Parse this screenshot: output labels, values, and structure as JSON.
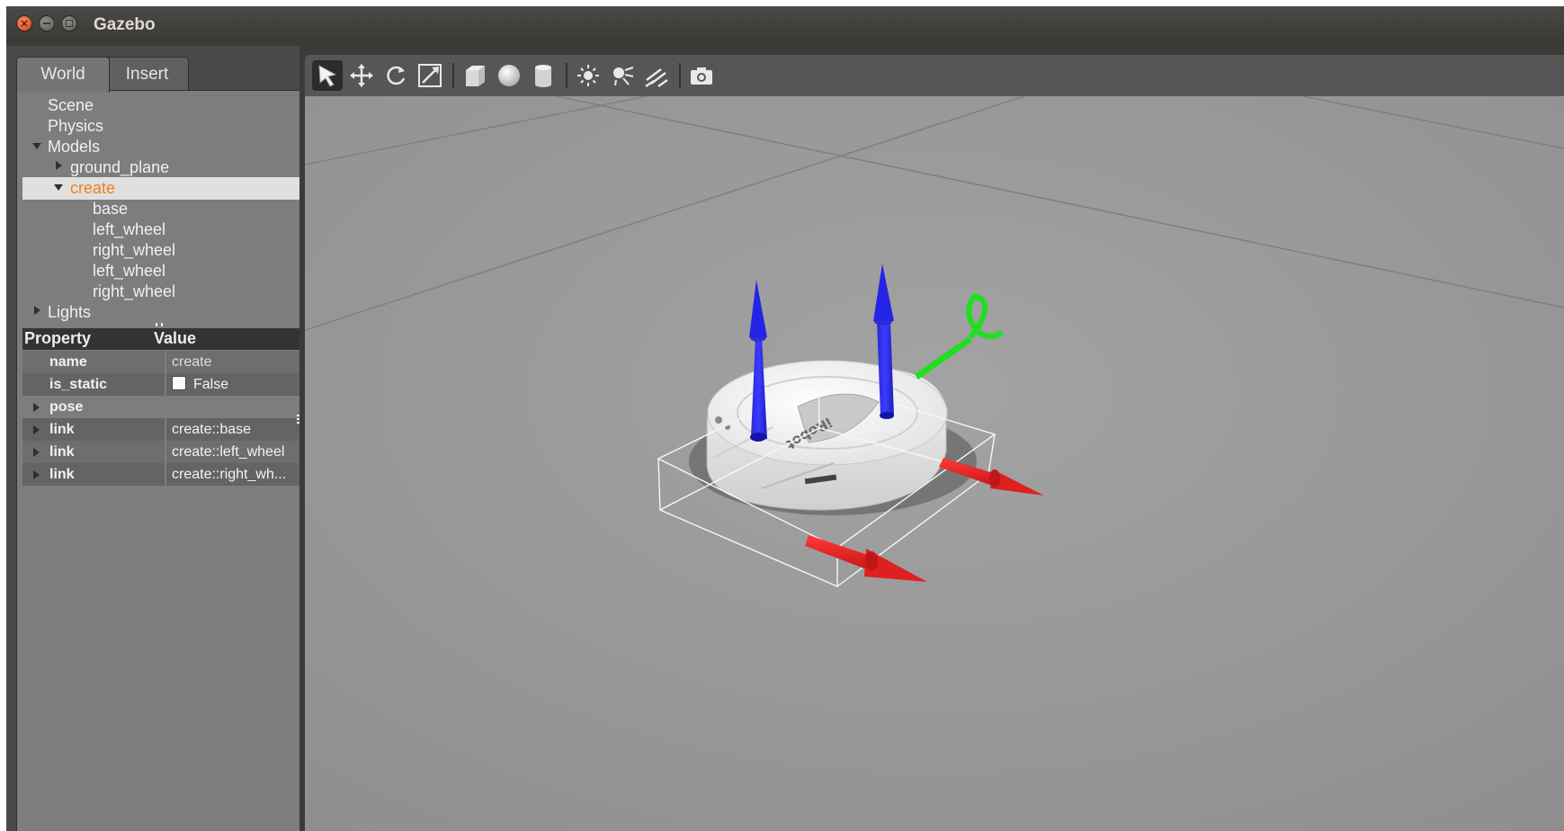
{
  "window": {
    "title": "Gazebo",
    "close_glyph": "×"
  },
  "tabs": [
    {
      "label": "World"
    },
    {
      "label": "Insert"
    }
  ],
  "tree": {
    "scene": "Scene",
    "physics": "Physics",
    "models": "Models",
    "ground_plane": "ground_plane",
    "create": "create",
    "links": [
      "base",
      "left_wheel",
      "right_wheel",
      "left_wheel",
      "right_wheel"
    ],
    "lights": "Lights"
  },
  "properties": {
    "header_property": "Property",
    "header_value": "Value",
    "rows": [
      {
        "key": "name",
        "value": "create"
      },
      {
        "key": "is_static",
        "value": "False"
      },
      {
        "key": "pose",
        "value": ""
      },
      {
        "key": "link",
        "value": "create::base"
      },
      {
        "key": "link",
        "value": "create::left_wheel"
      },
      {
        "key": "link",
        "value": "create::right_wh..."
      }
    ]
  },
  "toolbar": {
    "tools": [
      "select-icon",
      "translate-icon",
      "rotate-icon",
      "scale-icon",
      "box-icon",
      "sphere-icon",
      "cylinder-icon",
      "point-light-icon",
      "spot-light-icon",
      "directional-light-icon",
      "screenshot-icon"
    ]
  },
  "scene_model": {
    "robot_label": "iRobot",
    "colors": {
      "background": "#9a9a9a",
      "x_axis": "#e02222",
      "y_axis": "#22dd22",
      "z_axis": "#1a1aee",
      "selection": "#f07f1a"
    }
  }
}
